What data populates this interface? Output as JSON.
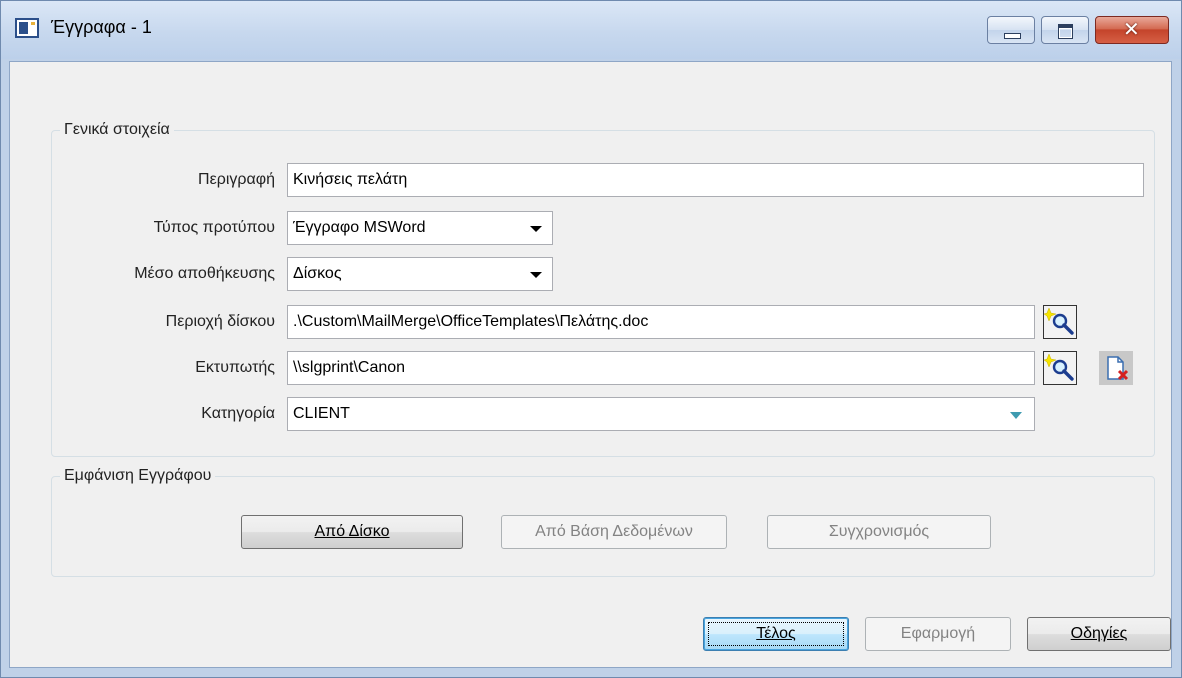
{
  "window": {
    "title": "Έγγραφα - 1"
  },
  "general": {
    "legend": "Γενικά στοιχεία",
    "description_label": "Περιγραφή",
    "description_value": "Κινήσεις πελάτη",
    "template_type_label": "Τύπος προτύπου",
    "template_type_value": "Έγγραφο MSWord",
    "storage_label": "Μέσο αποθήκευσης",
    "storage_value": "Δίσκος",
    "disk_path_label": "Περιοχή δίσκου",
    "disk_path_value": ".\\Custom\\MailMerge\\OfficeTemplates\\Πελάτης.doc",
    "printer_label": "Εκτυπωτής",
    "printer_value": "\\\\slgprint\\Canon",
    "category_label": "Κατηγορία",
    "category_value": "CLIENT"
  },
  "display": {
    "legend": "Εμφάνιση Εγγράφου",
    "from_disk": "Από Δίσκο",
    "from_database": "Από Βάση Δεδομένων",
    "synchronize": "Συγχρονισμός"
  },
  "footer": {
    "finish": "Τέλος",
    "apply": "Εφαρμογή",
    "help": "Οδηγίες"
  },
  "icons": {
    "browse": "magnifier-sparkle-icon",
    "clear": "document-delete-icon",
    "dropdown": "chevron-down-icon"
  },
  "colors": {
    "titlebar": "#c7d8ee",
    "client": "#f0f0f0",
    "default_button": "#bee6fd",
    "close_button": "#c4442b"
  }
}
